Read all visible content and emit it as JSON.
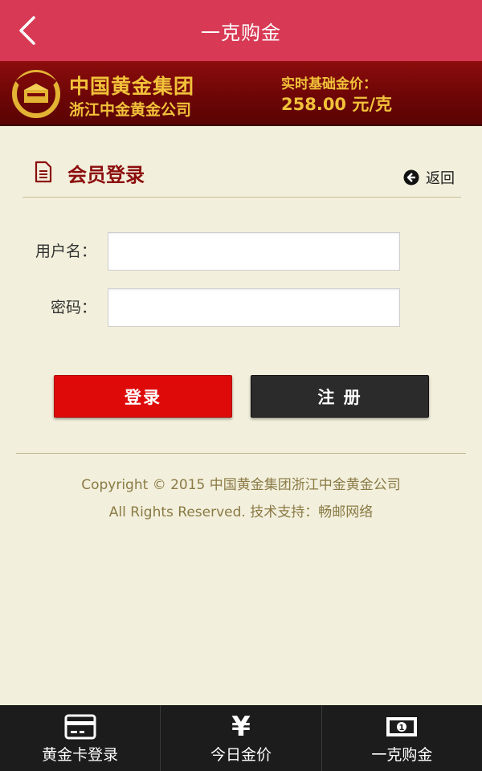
{
  "appbar": {
    "title": "一克购金",
    "back_icon": "chevron-left-icon"
  },
  "brand": {
    "name_line1": "中国黄金集团",
    "name_line2": "浙江中金黄金公司",
    "price_label": "实时基础金价：",
    "price_value": "258.00 元/克",
    "menu_icon": "hamburger-menu-icon"
  },
  "login": {
    "title": "会员登录",
    "return_label": "返回",
    "username_label": "用户名：",
    "username_value": "",
    "password_label": "密码：",
    "password_value": "",
    "login_button": "登录",
    "register_button": "注 册"
  },
  "footer": {
    "copyright_line1": "Copyright © 2015 中国黄金集团浙江中金黄金公司",
    "copyright_line2": "All Rights Reserved. 技术支持：畅邮网络"
  },
  "bottom_nav": [
    {
      "label": "黄金卡登录",
      "icon": "card-icon"
    },
    {
      "label": "今日金价",
      "icon": "yen-icon"
    },
    {
      "label": "一克购金",
      "icon": "banknote-icon"
    }
  ],
  "colors": {
    "appbar": "#d83a55",
    "brand_bg": "#7a0808",
    "gold_text": "#f2c23a",
    "page_bg": "#f2efdc",
    "login_button": "#de0a0a",
    "register_button": "#2b2b2b",
    "nav_bg": "#1c1c1c"
  }
}
